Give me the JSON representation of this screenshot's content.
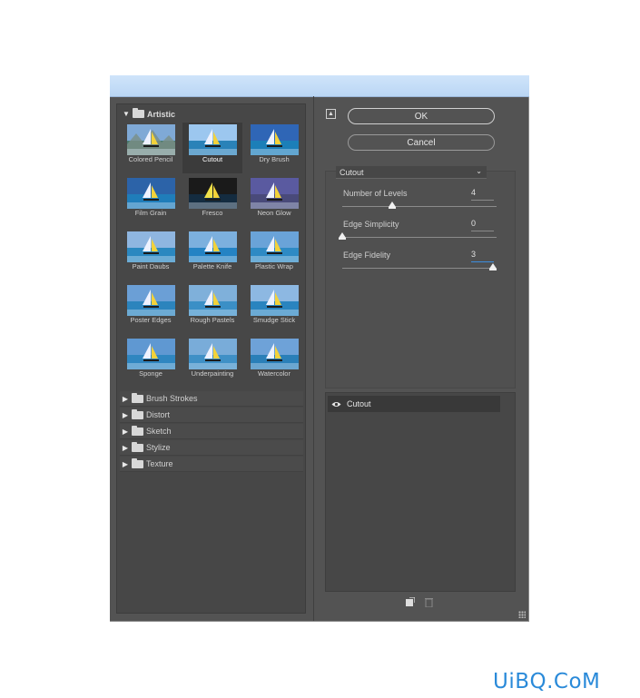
{
  "filter_gallery": {
    "expanded_category": "Artistic",
    "thumbnails": [
      {
        "label": "Colored Pencil"
      },
      {
        "label": "Cutout"
      },
      {
        "label": "Dry Brush"
      },
      {
        "label": "Film Grain"
      },
      {
        "label": "Fresco"
      },
      {
        "label": "Neon Glow"
      },
      {
        "label": "Paint Daubs"
      },
      {
        "label": "Palette Knife"
      },
      {
        "label": "Plastic Wrap"
      },
      {
        "label": "Poster Edges"
      },
      {
        "label": "Rough Pastels"
      },
      {
        "label": "Smudge Stick"
      },
      {
        "label": "Sponge"
      },
      {
        "label": "Underpainting"
      },
      {
        "label": "Watercolor"
      }
    ],
    "selected_thumbnail": "Cutout",
    "collapsed_categories": [
      "Brush Strokes",
      "Distort",
      "Sketch",
      "Stylize",
      "Texture"
    ]
  },
  "buttons": {
    "ok": "OK",
    "cancel": "Cancel"
  },
  "filter_select": {
    "value": "Cutout"
  },
  "parameters": [
    {
      "label": "Number of Levels",
      "value": "4",
      "slider_fraction": 0.33
    },
    {
      "label": "Edge Simplicity",
      "value": "0",
      "slider_fraction": 0.0
    },
    {
      "label": "Edge Fidelity",
      "value": "3",
      "slider_fraction": 1.0
    }
  ],
  "effect_layers": [
    {
      "name": "Cutout",
      "visible": true
    }
  ],
  "icons": {
    "collapse": "collapse-icon",
    "visibility": "eye-icon",
    "new_layer": "new-effect-layer-icon",
    "delete": "trash-icon"
  },
  "watermark": "UiBQ.CoM",
  "colors": {
    "panel": "#535353",
    "accent": "#3c8ddd",
    "watermark": "#2a8ad9"
  }
}
